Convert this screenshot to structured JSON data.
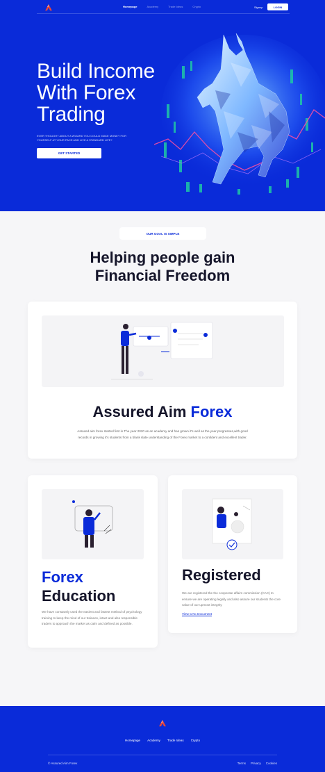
{
  "nav": {
    "links": [
      "Homepage",
      "Academy",
      "Trade Ideas",
      "Crypto"
    ],
    "active": "Homepage",
    "signup": "Signup",
    "login": "LOGIN"
  },
  "hero": {
    "title": "Build Income With Forex Trading",
    "subtitle": "EVER THOUGHT ABOUT A WIZARD YOU COULD MAKE MONEY FOR YOURSELF AT YOUR PACE AND LIVE A STANDARD LIFE?",
    "cta": "GET STARTED"
  },
  "goal": {
    "badge": "OUR GOAL IS SIMPLE",
    "title": "Helping people gain Financial Freedom"
  },
  "assured": {
    "title_part1": "Assured Aim",
    "title_part2": "Forex",
    "description": "Assured aim forex started first in The year 2020 as an academy and has grown it's well as the year progresses,with good records in growing it's students from a blank slate understanding of the Forex market to a confident and excellent trader."
  },
  "forex": {
    "title_part1": "Forex",
    "title_part2": "Education",
    "description": "We have constantly used the easiest and fastest method of psychology training to keep the mind of our trainees, intact and also responsible traders to approach the market as calm and defined as possible."
  },
  "registered": {
    "title": "Registered",
    "description": "We are registered the the cooperate affairs commission (CAC) to ensure we are operating legally and also assure our students the core value of our upmost integrity",
    "link": "View CAC Document"
  },
  "footer": {
    "links": [
      "Homepage",
      "Academy",
      "Trade Ideas",
      "Crypto"
    ],
    "copyright": "© Assured Aim Forex",
    "legal": [
      "Terms",
      "Privacy",
      "Cookies"
    ]
  },
  "colors": {
    "brand_blue": "#0a2bd9",
    "logo_red": "#e8483a"
  }
}
